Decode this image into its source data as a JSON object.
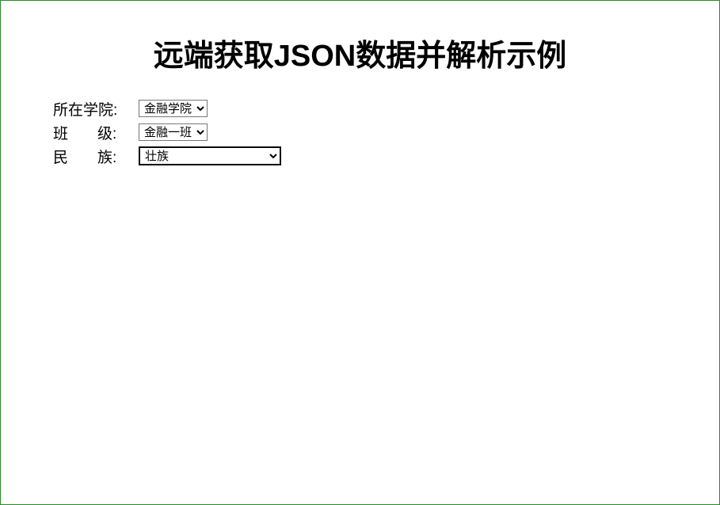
{
  "title": "远端获取JSON数据并解析示例",
  "form": {
    "college": {
      "label": "所在学院:",
      "selected": "金融学院"
    },
    "class": {
      "label": "班       级:",
      "selected": "金融一班"
    },
    "ethnicity": {
      "label": "民       族:",
      "selected": "壮族"
    }
  }
}
